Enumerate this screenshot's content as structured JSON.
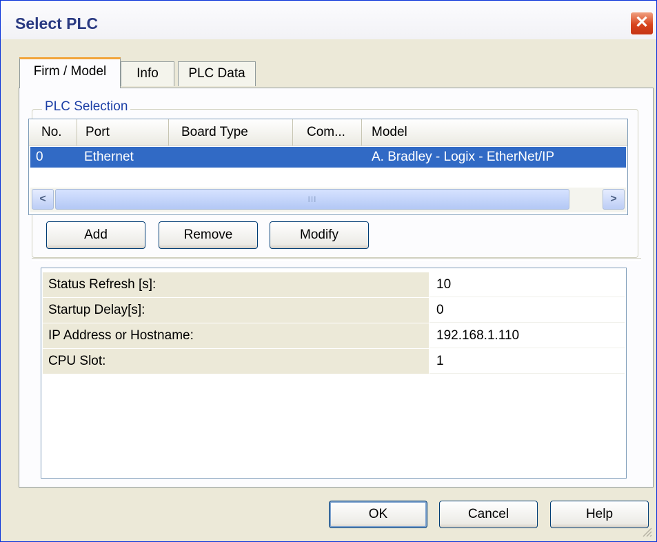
{
  "window": {
    "title": "Select PLC"
  },
  "tabs": [
    {
      "label": "Firm / Model",
      "active": true
    },
    {
      "label": "Info",
      "active": false
    },
    {
      "label": "PLC Data",
      "active": false
    }
  ],
  "plc_selection": {
    "group_label": "PLC Selection",
    "columns": [
      "No.",
      "Port",
      "Board Type",
      "Com...",
      "Model"
    ],
    "rows": [
      {
        "no": "0",
        "port": "Ethernet",
        "board_type": "",
        "com": "",
        "model": "A. Bradley - Logix - EtherNet/IP",
        "selected": true
      }
    ],
    "scrollbar": {
      "thumb_grip": "III"
    }
  },
  "buttons": {
    "add": "Add",
    "remove": "Remove",
    "modify": "Modify"
  },
  "properties": [
    {
      "name": "Status Refresh [s]:",
      "value": "10"
    },
    {
      "name": "Startup Delay[s]:",
      "value": "0"
    },
    {
      "name": "IP Address or Hostname:",
      "value": "192.168.1.110"
    },
    {
      "name": "CPU Slot:",
      "value": "1"
    }
  ],
  "footer": {
    "ok": "OK",
    "cancel": "Cancel",
    "help": "Help"
  },
  "colors": {
    "selection": "#316ac5",
    "dialog_bg": "#ECE9D8",
    "tab_highlight": "#f1a43a",
    "group_label": "#1c3fa6"
  }
}
